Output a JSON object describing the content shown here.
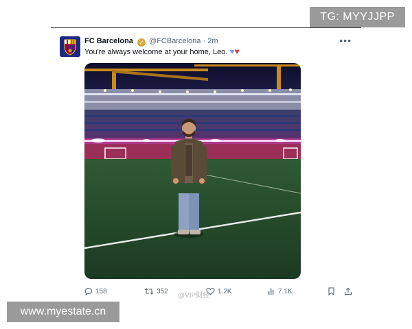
{
  "overlays": {
    "telegram": "TG: MYYJJPP",
    "website": "www.myestate.cn"
  },
  "tweet": {
    "author_name": "FC Barcelona",
    "handle": "@FCBarcelona",
    "separator": "·",
    "time": "2m",
    "text": "You're always welcome at your home, Leo.",
    "emoji": [
      "blue-heart",
      "red-heart"
    ],
    "photo_icon": "camp-nou-photo"
  },
  "actions": {
    "replies": "158",
    "retweets": "352",
    "likes": "1.2K",
    "views": "7.1K"
  },
  "watermark": "@VIP财经"
}
